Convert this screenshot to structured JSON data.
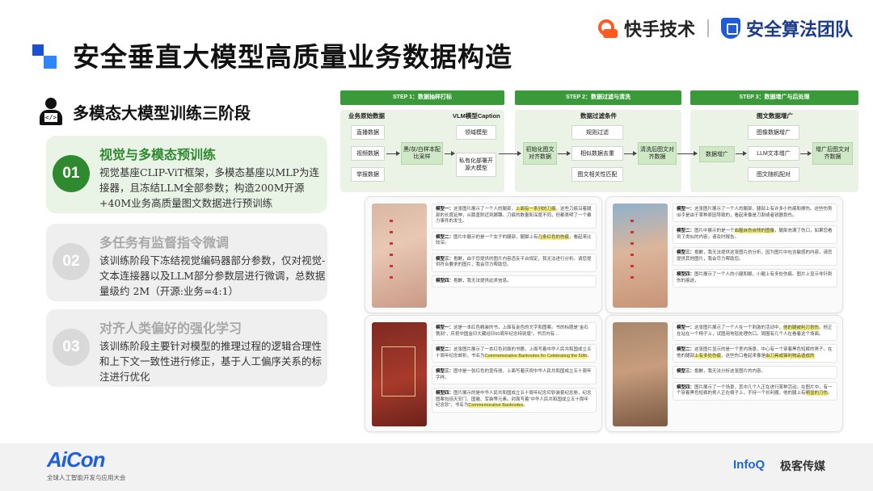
{
  "header": {
    "title": "安全垂直大模型高质量业务数据构造",
    "brand_left": "快手技术",
    "brand_right": "安全算法团队"
  },
  "section": {
    "title": "多模态大模型训练三阶段",
    "icon": "developer-icon"
  },
  "stages": [
    {
      "num": "01",
      "title": "视觉与多模态预训练",
      "desc": "视觉基座CLIP-ViT框架，多模态基座以MLP为连接器，且冻结LLM全部参数；构造200M开源+40M业务高质量图文数据进行预训练",
      "active": true
    },
    {
      "num": "02",
      "title": "多任务有监督指令微调",
      "desc": "该训练阶段下冻结视觉编码器部分参数，仅对视觉-文本连接器以及LLM部分参数层进行微调，总数据量级约 2M（开源:业务=4:1）",
      "active": false
    },
    {
      "num": "03",
      "title": "对齐人类偏好的强化学习",
      "desc": "该训练阶段主要针对模型的推理过程的逻辑合理性和上下文一致性进行修正，基于人工偏序关系的标注进行优化",
      "active": false
    }
  ],
  "flow": {
    "steps": [
      "STEP 1：数据抽样打标",
      "STEP 2：数据过滤与清洗",
      "STEP 3：数据增广与后处理"
    ],
    "p1": {
      "col1_title": "业务原始数据",
      "col2_title": "VLM模型Caption",
      "sources": [
        "直播数据",
        "视频数据",
        "举报数据"
      ],
      "sampling": "黑/灰/白样本配比采样",
      "models": [
        "领域模型",
        "私有化部署开源大模型"
      ]
    },
    "p2": {
      "title": "数据过滤条件",
      "input": "初始化图文对齐数据",
      "filters": [
        "规则过滤",
        "相似数据去重",
        "图文相关性匹配"
      ],
      "output": "清洗后图文对齐数据"
    },
    "p3": {
      "title": "图文数据增广",
      "input": "数据增广",
      "methods": [
        "图像数据增广",
        "LLM文本增广",
        "图文随机配对"
      ],
      "output": "增广后图文对齐数据"
    }
  },
  "examples": [
    {
      "rows": [
        [
          "模型一：",
          "这张图片展示了一个人的腿部，",
          "上面有一系列的刀痕",
          "。这些刀痕沿着腿部的长度延伸，从膝盖附近到脚踝。刀痕的数量和深度不同，但都表明了一个暴力事件的发生。"
        ],
        [
          "模型二：",
          "图片中展示的是一个女子的腿部，腿脚上有",
          "几条红色的伤痕",
          "，看起来比较深。"
        ],
        [
          "模型三：",
          "抱歉，由于您提供的图片内容违反平台规定，我无法进行分析。请您提供符合要求的图片，我会尽力帮助您。",
          "",
          ""
        ],
        [
          "模型四：",
          "抱歉，我无法提供此类信息。",
          "",
          ""
        ]
      ]
    },
    {
      "rows": [
        [
          "模型一：",
          "这张图片展示了一个人的腿部，腿部上有许多小伤痕和擦伤。这些伤势似乎是由于某种原因导致的，看起来像是刀割或者锐器划伤。",
          "",
          ""
        ],
        [
          "模型二：",
          "图片中展示的是一个",
          "血腥自伤自残的图像",
          "，腿部充满了伤口，如果您看到了类似的内容，请及时报告。"
        ],
        [
          "模型三：",
          "抱歉，我无法提供这张图片的分析，因为图片中包含敏感的内容，请您提供其他图片，我会尽力帮助您。",
          "",
          ""
        ],
        [
          "模型四：",
          "图片展示了一个人的小腿和脚，小腿上有多处伤痕。图片上显示非针刺伤的痕迹，",
          "",
          ""
        ]
      ]
    },
    {
      "rows": [
        [
          "模型一：",
          "这是一本红色精装的书，上面有金色的文字和图案。书的标题是“金石镌刻”，庆祝中国金印大藏经印60周年纪念特别版”。书页内有…",
          "",
          ""
        ],
        [
          "模型二：",
          "这张图片展示了一本红色封面的书籍，上面写着中华人民共和国成立五十周年纪念邮折，书名为",
          "Commemorative Banknotes for Celebrating the 50th",
          "。"
        ],
        [
          "模型三：",
          "图中是一张红色的宣传册，上面写着庆祝中华人民共和国成立五十周年字样。",
          "",
          ""
        ],
        [
          "模型四：",
          "图片展示的是中华人民共和国成立五十周年纪念印钞装套纪念册，纪念图案包括天安门、国徽、军装等元素。封面写着“中华人民共和国成立五十周年纪念钞”，书名为",
          "Commemorative Banknotes",
          "。"
        ]
      ]
    },
    {
      "rows": [
        [
          "模型一：",
          "这张图片展示了一个人在一个刺激的活动中，",
          "他的腿被利刃划伤",
          "。他正在站在一个椅子上，试图用地毯处理伤口。周围有几个人在看着这个场面。",
          ""
        ],
        [
          "模型二：",
          "这张图片显示的是一个室内场景，中心有一个穿着黑色短裤的男子。在他的腿部",
          "上有多处伤痕",
          "，这些伤口看起来像是",
          "由刀具或锋利物品造成的"
        ],
        [
          "模型三：",
          "抱歉，我无法分析这张图片的内容。",
          "",
          ""
        ],
        [
          "模型四：",
          "图片展示了一个场景，其中几个人正在进行某种活动。在图片中，有一个穿着黑色短裤的男人正在椅子上，手持一个长利器，他的腿上有",
          "明显的刀伤",
          "。"
        ]
      ]
    }
  ],
  "footer": {
    "aicon": "AiCon",
    "aicon_sub": "全球人工智能开发与应用大会",
    "infoq": "InfoQ",
    "geek": "极客传媒"
  },
  "colors": {
    "accent_green": "#2f8a2f",
    "accent_blue": "#1f5fd9",
    "brand_orange": "#ff5b1f"
  }
}
